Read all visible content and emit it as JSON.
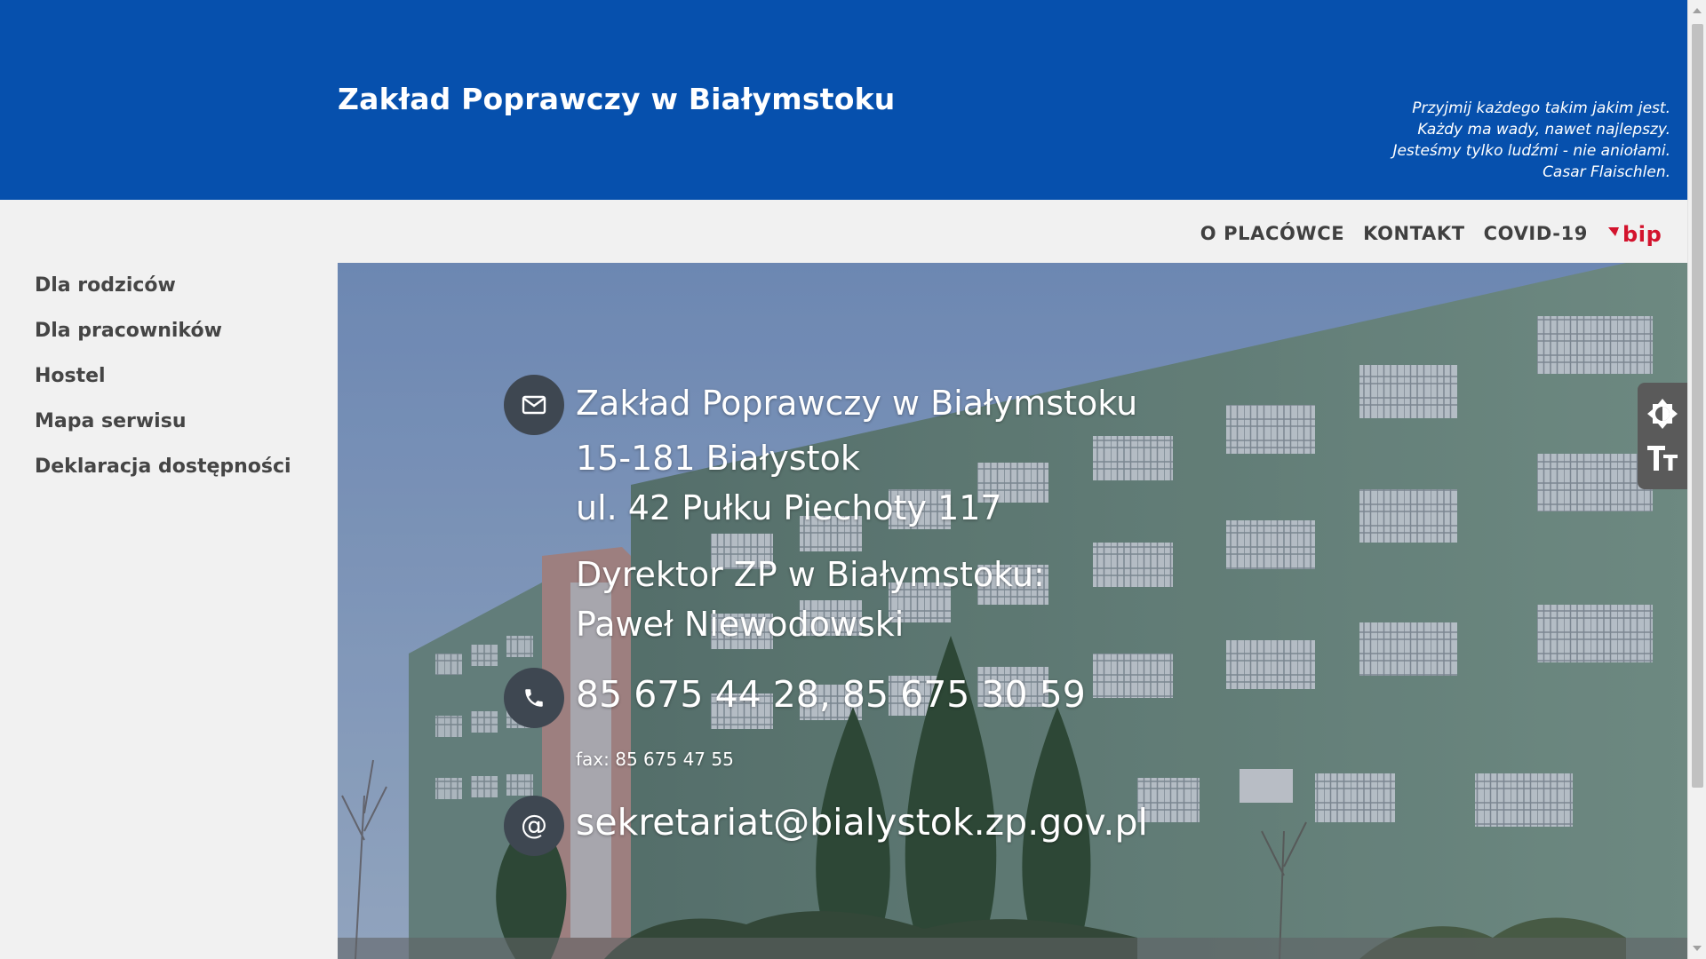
{
  "header": {
    "title": "Zakład Poprawczy w Białymstoku",
    "quote": [
      "Przyjmij każdego takim jakim jest.",
      "Każdy ma wady, nawet najlepszy.",
      "Jesteśmy tylko ludźmi - nie aniołami.",
      "Casar Flaischlen."
    ]
  },
  "nav": {
    "items": [
      {
        "label": "O PLACÓWCE"
      },
      {
        "label": "KONTAKT"
      },
      {
        "label": "COVID-19"
      }
    ],
    "bip_label": "bip"
  },
  "sidebar": {
    "items": [
      {
        "label": "Dla rodziców"
      },
      {
        "label": "Dla pracowników"
      },
      {
        "label": "Hostel"
      },
      {
        "label": "Mapa serwisu"
      },
      {
        "label": "Deklaracja dostępności"
      }
    ]
  },
  "contact": {
    "name": "Zakład Poprawczy w Białymstoku",
    "postal": "15-181 Białystok",
    "street": "ul. 42 Pułku Piechoty 117",
    "director_title": "Dyrektor ZP w Białymstoku:",
    "director_name": "Paweł Niewodowski",
    "phones": "85 675 44 28, 85 675 30 59",
    "fax": "fax: 85 675 47 55",
    "email": "sekretariat@bialystok.zp.gov.pl"
  },
  "icons": {
    "mail": "envelope-icon",
    "phone": "phone-icon",
    "email": "at-icon",
    "contrast": "contrast-icon",
    "font_size": "text-size-icon"
  },
  "colors": {
    "header_bg": "#0650ad",
    "page_bg": "#f1f1f1",
    "nav_text": "#404040",
    "bip_red": "#d3132d"
  }
}
